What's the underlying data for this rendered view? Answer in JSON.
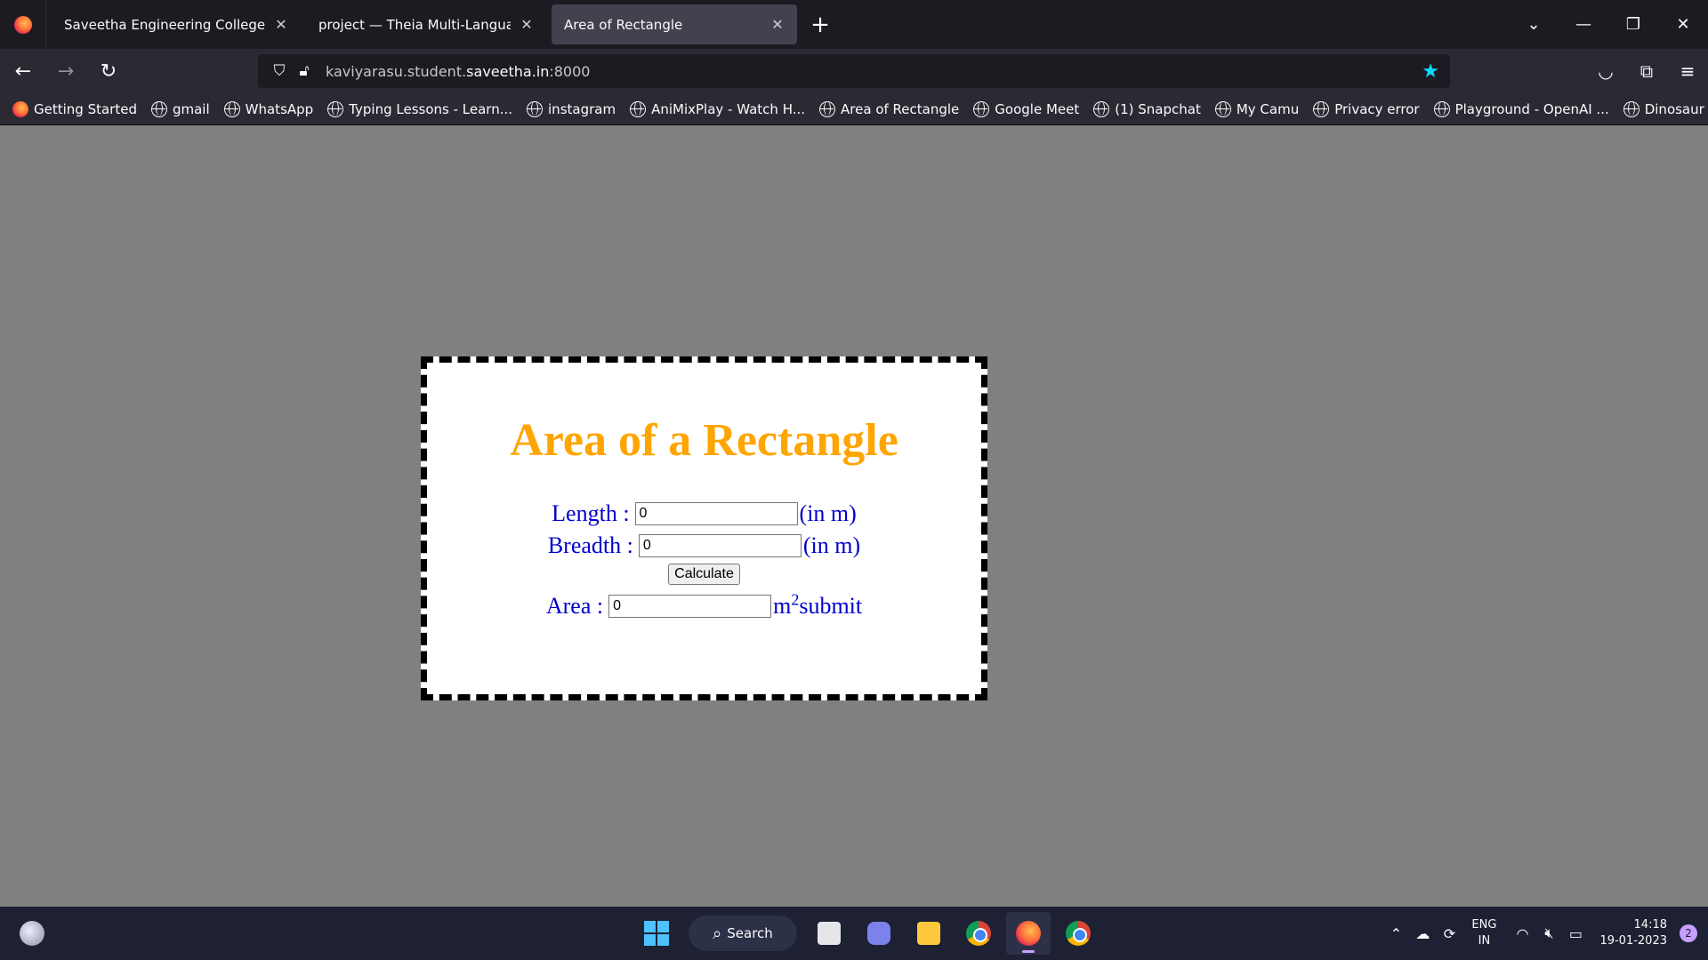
{
  "browser": {
    "tabs": [
      {
        "title": "Saveetha Engineering College",
        "active": false
      },
      {
        "title": "project — Theia Multi-Language Ex",
        "active": false
      },
      {
        "title": "Area of Rectangle",
        "active": true
      }
    ],
    "url_prefix": "kaviyarasu.student.",
    "url_domain": "saveetha.in",
    "url_suffix": ":8000",
    "bookmarks": [
      {
        "label": "Getting Started",
        "icon": "firefox-icon"
      },
      {
        "label": "gmail",
        "icon": "globe-icon"
      },
      {
        "label": "WhatsApp",
        "icon": "globe-icon"
      },
      {
        "label": "Typing Lessons - Learn...",
        "icon": "globe-icon"
      },
      {
        "label": "instagram",
        "icon": "globe-icon"
      },
      {
        "label": "AniMixPlay - Watch H...",
        "icon": "globe-icon"
      },
      {
        "label": "Area of Rectangle",
        "icon": "globe-icon"
      },
      {
        "label": "Google Meet",
        "icon": "globe-icon"
      },
      {
        "label": "(1) Snapchat",
        "icon": "globe-icon"
      },
      {
        "label": "My Camu",
        "icon": "globe-icon"
      },
      {
        "label": "Privacy error",
        "icon": "globe-icon"
      },
      {
        "label": "Playground - OpenAI ...",
        "icon": "globe-icon"
      },
      {
        "label": "Dinosaur Game",
        "icon": "globe-icon"
      }
    ]
  },
  "page": {
    "heading": "Area of a Rectangle",
    "length_label": "Length :",
    "length_value": "0",
    "length_unit": "(in m)",
    "breadth_label": "Breadth :",
    "breadth_value": "0",
    "breadth_unit": "(in m)",
    "calculate_label": "Calculate",
    "area_label": "Area :",
    "area_value": "0",
    "area_unit": "m",
    "area_unit_sup": "2",
    "area_suffix": "submit"
  },
  "taskbar": {
    "search_label": "Search",
    "lang_line1": "ENG",
    "lang_line2": "IN",
    "time": "14:18",
    "date": "19-01-2023",
    "notification_count": "2"
  },
  "colors": {
    "heading": "#ffa500",
    "text": "#0000cd",
    "page_bg": "#808080",
    "bookmark_star": "#00ddff"
  }
}
